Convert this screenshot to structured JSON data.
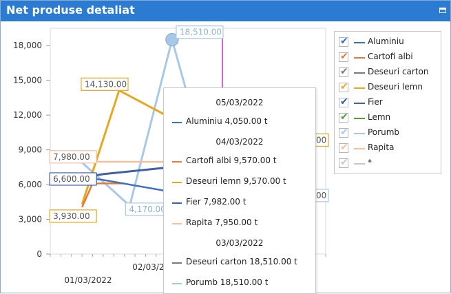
{
  "window": {
    "title": "Net produse detaliat"
  },
  "colors": {
    "title_bar": "#2b7bd3",
    "cursor_line": "#c533c5",
    "series": {
      "Aluminiu": "#3c6fbd",
      "Cartofi albi": "#e07b39",
      "Deseuri carton": "#7a7a7a",
      "Deseuri lemn": "#e5a823",
      "Fier": "#3f5fa6",
      "Lemn": "#5a9e3a",
      "Porumb": "#a9c8e6",
      "Rapita": "#f4bf9f",
      "*": "#c8c8c8"
    }
  },
  "legend": {
    "items": [
      {
        "label": "Aluminiu",
        "checked": true,
        "color": "#3c6fbd",
        "check_color": "#2d6bc4"
      },
      {
        "label": "Cartofi albi",
        "checked": true,
        "color": "#e07b39",
        "check_color": "#e07b39"
      },
      {
        "label": "Deseuri carton",
        "checked": true,
        "color": "#7a7a7a",
        "check_color": "#7a7a7a"
      },
      {
        "label": "Deseuri lemn",
        "checked": true,
        "color": "#e5a823",
        "check_color": "#e5a823"
      },
      {
        "label": "Fier",
        "checked": true,
        "color": "#3f5fa6",
        "check_color": "#2d5aa0"
      },
      {
        "label": "Lemn",
        "checked": true,
        "color": "#5a9e3a",
        "check_color": "#4e9a35"
      },
      {
        "label": "Porumb",
        "checked": true,
        "color": "#a9c8e6",
        "check_color": "#a9c8e6"
      },
      {
        "label": "Rapita",
        "checked": true,
        "color": "#f4bf9f",
        "check_color": "#f4bf9f"
      },
      {
        "label": "*",
        "checked": true,
        "color": "#c8c8c8",
        "check_color": "#c8c8c8"
      }
    ]
  },
  "tooltip": {
    "groups": [
      {
        "date": "05/03/2022",
        "rows": [
          {
            "text": "Aluminiu 4,050.00 t",
            "color": "#3c6fbd"
          }
        ]
      },
      {
        "date": "04/03/2022",
        "rows": [
          {
            "text": "Cartofi albi 9,570.00 t",
            "color": "#e07b39"
          },
          {
            "text": "Deseuri lemn 9,570.00 t",
            "color": "#e5a823"
          },
          {
            "text": "Fier 7,982.00 t",
            "color": "#3f5fa6"
          },
          {
            "text": "Rapita 7,950.00 t",
            "color": "#f4bf9f"
          }
        ]
      },
      {
        "date": "03/03/2022",
        "rows": [
          {
            "text": "Deseuri carton 18,510.00 t",
            "color": "#7a7a7a"
          },
          {
            "text": "Porumb 18,510.00 t",
            "color": "#a9c8e6"
          }
        ]
      }
    ]
  },
  "chart_data": {
    "type": "line",
    "ylim": [
      0,
      19500
    ],
    "yticks": [
      0,
      3000,
      6000,
      9000,
      12000,
      15000,
      18000
    ],
    "ytick_labels": [
      "0",
      "3,000",
      "6,000",
      "9,000",
      "12,000",
      "15,000",
      "18,000"
    ],
    "x": [
      "01/03/2022",
      "02/03/2022",
      "03/03/2022",
      "04/03/2022",
      "05/03/2022"
    ],
    "xtick_labels_row1": [
      "",
      "02/03/2022",
      "",
      "04/",
      ""
    ],
    "xtick_labels_row2": [
      "01/03/2022",
      "",
      "03/03/2022",
      "",
      ""
    ],
    "cursor_x": 3.25,
    "series": [
      {
        "name": "Porumb",
        "points": [
          [
            0.6,
            7900
          ],
          [
            1.5,
            4170
          ],
          [
            2.3,
            18510
          ],
          [
            3.0,
            7000
          ],
          [
            3.3,
            5000
          ]
        ]
      },
      {
        "name": "Deseuri lemn",
        "points": [
          [
            0.6,
            4300
          ],
          [
            1.3,
            14130
          ],
          [
            3.0,
            10000
          ],
          [
            3.3,
            9570
          ]
        ]
      },
      {
        "name": "Rapita",
        "points": [
          [
            0.6,
            7980
          ],
          [
            3.3,
            7950
          ]
        ]
      },
      {
        "name": "Cartofi albi",
        "points": [
          [
            0.6,
            4050
          ],
          [
            0.8,
            6100
          ],
          [
            1.4,
            6100
          ]
        ]
      },
      {
        "name": "Fier",
        "points": [
          [
            0.6,
            6600
          ],
          [
            1.0,
            6900
          ],
          [
            3.3,
            7982
          ]
        ]
      },
      {
        "name": "Aluminiu",
        "points": [
          [
            0.6,
            6600
          ],
          [
            1.0,
            6400
          ],
          [
            3.0,
            4800
          ],
          [
            3.3,
            4900
          ]
        ]
      }
    ],
    "data_labels": [
      {
        "text": "18,510.00",
        "series": "Porumb",
        "x": 2.3,
        "y": 18510
      },
      {
        "text": "14,130.00",
        "series": "Deseuri lemn",
        "x": 1.3,
        "y": 14130
      },
      {
        "text": "7,980.00",
        "series": "Rapita",
        "x": 0.6,
        "y": 7980
      },
      {
        "text": "6,600.00",
        "series": "Fier",
        "x": 0.6,
        "y": 6600
      },
      {
        "text": "3,930.00",
        "series": "Deseuri lemn",
        "x": 0.6,
        "y": 3930
      },
      {
        "text": "4,170.00",
        "series": "Porumb",
        "x": 1.5,
        "y": 4170
      }
    ],
    "partial_labels": [
      {
        "text": "00",
        "series": "Deseuri lemn",
        "y": 8000
      },
      {
        "text": "00",
        "series": "Porumb",
        "y": 5300
      }
    ]
  }
}
